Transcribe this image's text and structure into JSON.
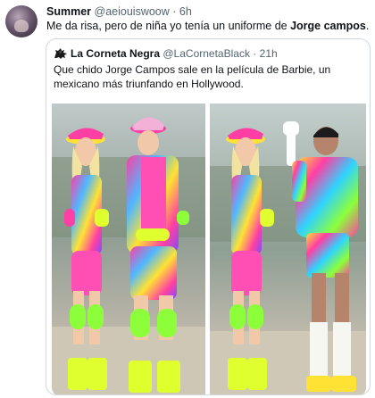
{
  "tweet": {
    "author_name": "Summer",
    "author_handle": "@aeiouiswoow",
    "separator": "·",
    "time": "6h",
    "text_before": "Me da risa, pero de niña yo tenía un uniforme de ",
    "text_bold": "Jorge campos",
    "text_after": "."
  },
  "quoted": {
    "author_name": "La Corneta Negra",
    "author_handle": "@LaCornetaBlack",
    "separator": "·",
    "time": "21h",
    "text": "Que chido Jorge Campos sale en la película de Barbie,  un mexicano más triunfando en Hollywood."
  },
  "colors": {
    "text": "#0f1419",
    "secondary": "#536471",
    "border": "#cfd9de",
    "neon_pink": "#ff3fa4",
    "neon_yellow": "#dfff2e",
    "neon_green": "#8cff3a"
  },
  "icons": {
    "quoted_avatar": "black-horse-logo-icon"
  }
}
